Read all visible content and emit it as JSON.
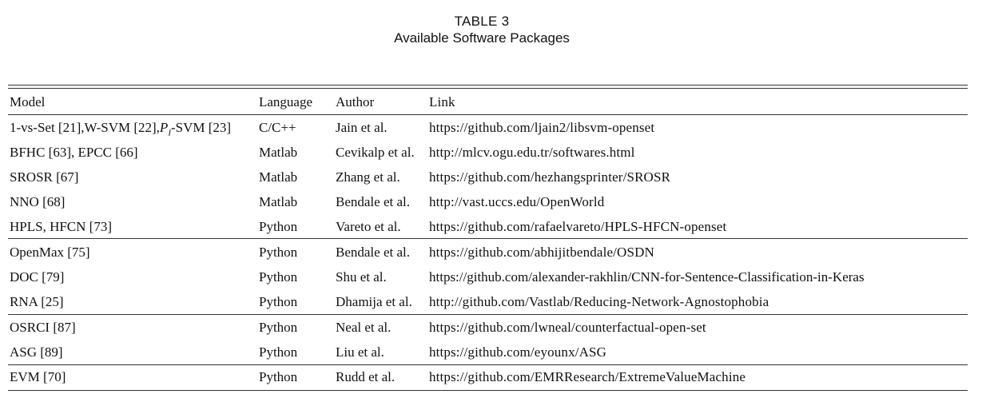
{
  "caption": {
    "label": "TABLE 3",
    "title": "Available Software Packages"
  },
  "table": {
    "headers": {
      "model": "Model",
      "language": "Language",
      "author": "Author",
      "link": "Link"
    },
    "rows": [
      {
        "model": "1-vs-Set [21],W-SVM [22],P_I-SVM [23]",
        "language": "C/C++",
        "author": "Jain et al.",
        "link": "https://github.com/ljain2/libsvm-openset"
      },
      {
        "model": "BFHC [63], EPCC [66]",
        "language": "Matlab",
        "author": "Cevikalp et al.",
        "link": "http://mlcv.ogu.edu.tr/softwares.html"
      },
      {
        "model": "SROSR [67]",
        "language": "Matlab",
        "author": "Zhang et al.",
        "link": "https://github.com/hezhangsprinter/SROSR"
      },
      {
        "model": "NNO [68]",
        "language": "Matlab",
        "author": "Bendale et al.",
        "link": "http://vast.uccs.edu/OpenWorld"
      },
      {
        "model": "HPLS, HFCN [73]",
        "language": "Python",
        "author": "Vareto et al.",
        "link": "https://github.com/rafaelvareto/HPLS-HFCN-openset"
      },
      {
        "model": "OpenMax [75]",
        "language": "Python",
        "author": "Bendale et al.",
        "link": "https://github.com/abhijitbendale/OSDN"
      },
      {
        "model": "DOC [79]",
        "language": "Python",
        "author": "Shu et al.",
        "link": "https://github.com/alexander-rakhlin/CNN-for-Sentence-Classification-in-Keras"
      },
      {
        "model": "RNA [25]",
        "language": "Python",
        "author": "Dhamija et al.",
        "link": "http://github.com/Vastlab/Reducing-Network-Agnostophobia"
      },
      {
        "model": "OSRCI [87]",
        "language": "Python",
        "author": "Neal et al.",
        "link": "https://github.com/lwneal/counterfactual-open-set"
      },
      {
        "model": "ASG [89]",
        "language": "Python",
        "author": "Liu et al.",
        "link": "https://github.com/eyounx/ASG"
      },
      {
        "model": "EVM [70]",
        "language": "Python",
        "author": "Rudd et al.",
        "link": "https://github.com/EMRResearch/ExtremeValueMachine"
      }
    ]
  }
}
